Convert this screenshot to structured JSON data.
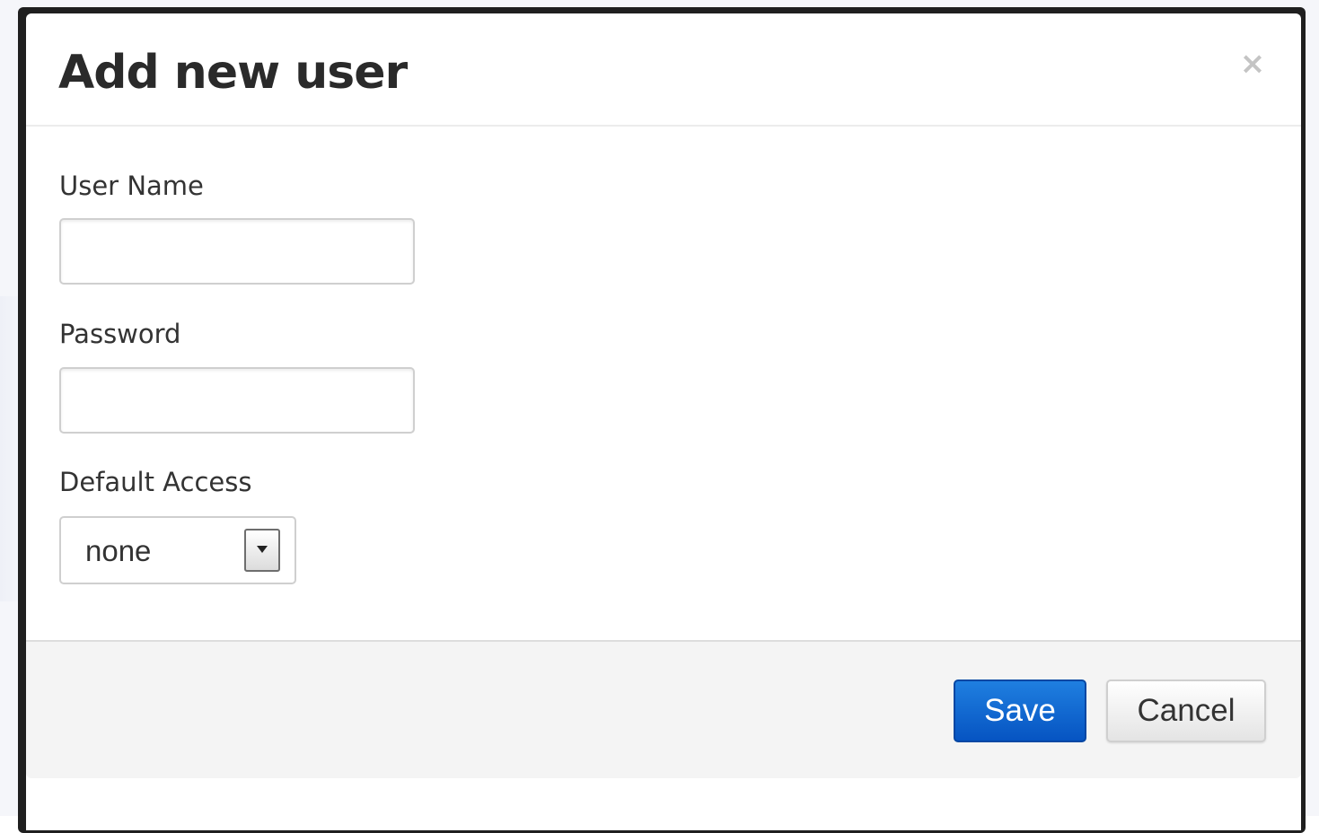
{
  "dialog": {
    "title": "Add new user",
    "close_label": "×"
  },
  "form": {
    "username": {
      "label": "User Name",
      "value": "",
      "placeholder": ""
    },
    "password": {
      "label": "Password",
      "value": "",
      "placeholder": ""
    },
    "default_access": {
      "label": "Default Access",
      "selected": "none"
    }
  },
  "footer": {
    "save_label": "Save",
    "cancel_label": "Cancel"
  },
  "colors": {
    "primary_button": "#0a62d0",
    "cancel_button": "#eeeeee"
  },
  "icons": {
    "close": "close-icon",
    "dropdown": "chevron-down-icon"
  }
}
